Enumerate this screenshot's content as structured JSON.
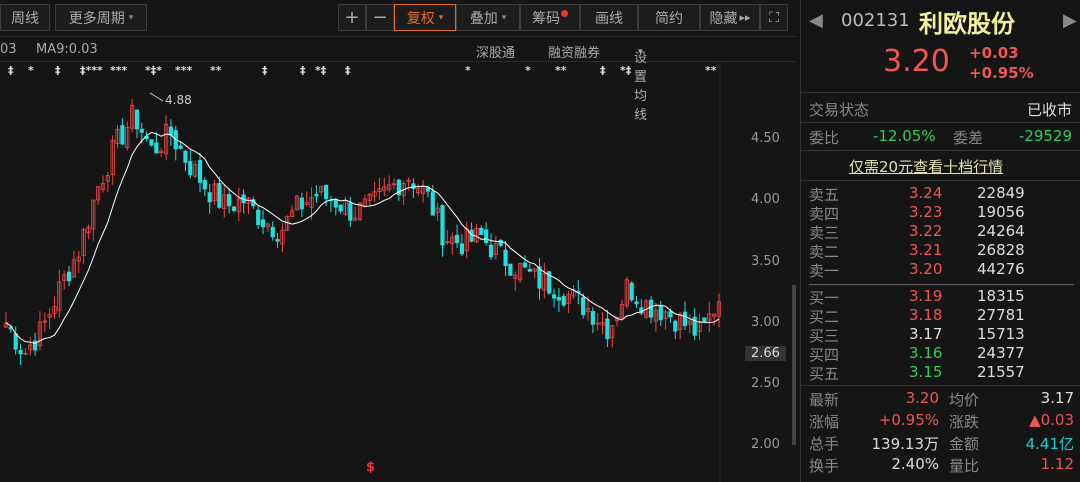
{
  "toolbar": {
    "weekly": "周线",
    "more_periods": "更多周期",
    "plus": "+",
    "minus": "−",
    "fuquan": "复权",
    "overlay": "叠加",
    "chips": "筹码",
    "draw": "画线",
    "simple": "简约",
    "hide": "隐藏",
    "caret": "▾",
    "hide_arrows": "▸▸",
    "fullscreen_icon": "⛶"
  },
  "subbar": {
    "ma_left": "03",
    "ma9": "MA9:0.03",
    "sgt": "深股通",
    "margin": "融资融券",
    "set_ma": "设置均线"
  },
  "markers": [
    "‡",
    "*",
    "‡",
    "‡***",
    "***",
    "*‡*",
    "***",
    "**",
    "‡",
    "‡",
    "*‡",
    "‡",
    "*",
    "*",
    "**",
    "‡",
    "*‡",
    "**"
  ],
  "colors": {
    "up": "#ee4444",
    "down": "#22dddd",
    "ma": "#ffffff",
    "accent": "#e07020"
  },
  "chart_data": {
    "type": "candlestick",
    "ylim": [
      2.0,
      4.95
    ],
    "yticks": [
      "4.50",
      "4.00",
      "3.50",
      "3.00",
      "2.50",
      "2.00"
    ],
    "current_marker": "2.66",
    "high_annotation": "4.88",
    "bottom_marker": "$",
    "close_keypoints": [
      3.0,
      2.75,
      2.95,
      3.3,
      3.6,
      4.1,
      4.45,
      4.7,
      4.4,
      4.55,
      4.3,
      4.1,
      3.95,
      4.0,
      3.85,
      3.75,
      3.95,
      4.05,
      4.0,
      3.9,
      3.95,
      4.1,
      4.2,
      4.05,
      3.7,
      3.65,
      3.7,
      3.55,
      3.45,
      3.35,
      3.3,
      3.2,
      3.1,
      2.95,
      3.3,
      3.15,
      3.1,
      3.0,
      2.9,
      3.2
    ]
  },
  "quote": {
    "code": "002131",
    "name": "利欧股份",
    "price": "3.20",
    "change": "+0.03",
    "pct": "+0.95%",
    "prev": "◀",
    "next": "▶"
  },
  "status": {
    "label": "交易状态",
    "value": "已收市"
  },
  "weibi": {
    "label": "委比",
    "value": "-12.05%",
    "diff_label": "委差",
    "diff_value": "-29529"
  },
  "promo": "仅需20元查看十档行情",
  "asks": [
    {
      "label": "卖五",
      "price": "3.24",
      "vol": "22849"
    },
    {
      "label": "卖四",
      "price": "3.23",
      "vol": "19056"
    },
    {
      "label": "卖三",
      "price": "3.22",
      "vol": "24264"
    },
    {
      "label": "卖二",
      "price": "3.21",
      "vol": "26828"
    },
    {
      "label": "卖一",
      "price": "3.20",
      "vol": "44276"
    }
  ],
  "bids": [
    {
      "label": "买一",
      "price": "3.19",
      "vol": "18315"
    },
    {
      "label": "买二",
      "price": "3.18",
      "vol": "27781"
    },
    {
      "label": "买三",
      "price": "3.17",
      "vol": "15713"
    },
    {
      "label": "买四",
      "price": "3.16",
      "vol": "24377"
    },
    {
      "label": "买五",
      "price": "3.15",
      "vol": "21557"
    }
  ],
  "stats": [
    {
      "l1": "最新",
      "v1": "3.20",
      "l2": "均价",
      "v2": "3.17"
    },
    {
      "l1": "涨幅",
      "v1": "+0.95%",
      "l2": "涨跌",
      "v2": "▲0.03"
    },
    {
      "l1": "总手",
      "v1": "139.13万",
      "l2": "金额",
      "v2": "4.41亿"
    },
    {
      "l1": "换手",
      "v1": "2.40%",
      "l2": "量比",
      "v2": "1.12"
    }
  ]
}
